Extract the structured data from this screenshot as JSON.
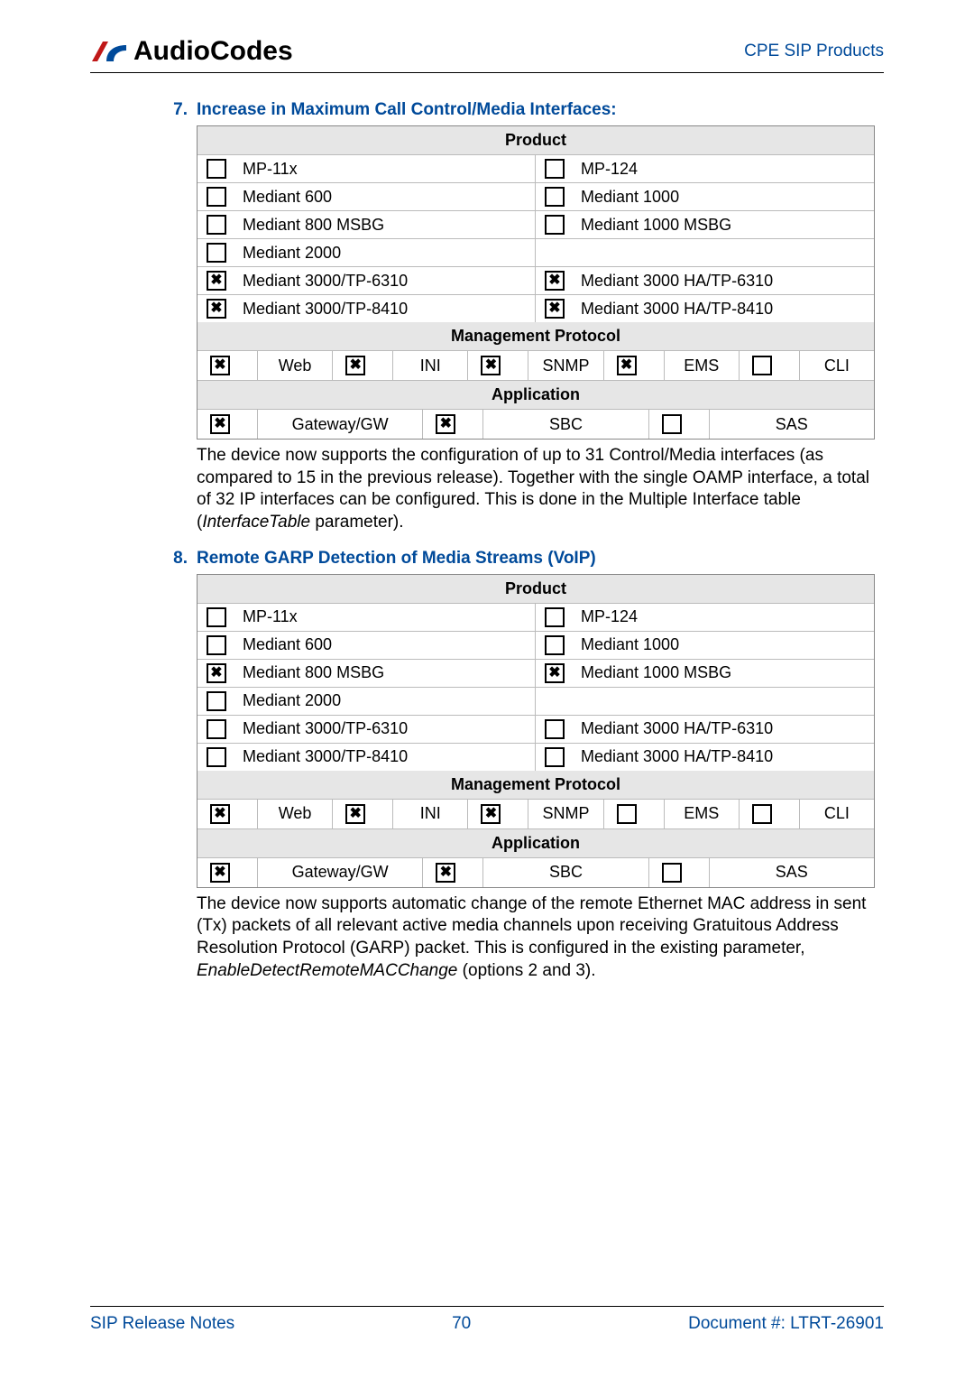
{
  "header": {
    "logo_text": "AudioCodes",
    "right_text": "CPE SIP Products"
  },
  "section7": {
    "num": "7.",
    "title": "Increase in Maximum Call Control/Media Interfaces:",
    "product_header": "Product",
    "products": [
      {
        "left": {
          "checked": false,
          "label": "MP-11x"
        },
        "right": {
          "checked": false,
          "label": "MP-124"
        }
      },
      {
        "left": {
          "checked": false,
          "label": "Mediant 600"
        },
        "right": {
          "checked": false,
          "label": "Mediant 1000"
        }
      },
      {
        "left": {
          "checked": false,
          "label": "Mediant 800 MSBG"
        },
        "right": {
          "checked": false,
          "label": "Mediant 1000 MSBG"
        }
      },
      {
        "left": {
          "checked": false,
          "label": "Mediant 2000"
        },
        "right": null
      },
      {
        "left": {
          "checked": true,
          "label": "Mediant 3000/TP-6310"
        },
        "right": {
          "checked": true,
          "label": "Mediant 3000 HA/TP-6310"
        }
      },
      {
        "left": {
          "checked": true,
          "label": "Mediant 3000/TP-8410"
        },
        "right": {
          "checked": true,
          "label": "Mediant 3000 HA/TP-8410"
        }
      }
    ],
    "mgmt_header": "Management Protocol",
    "mgmt": [
      {
        "checked": true,
        "label": "Web"
      },
      {
        "checked": true,
        "label": "INI"
      },
      {
        "checked": true,
        "label": "SNMP"
      },
      {
        "checked": true,
        "label": "EMS"
      },
      {
        "checked": false,
        "label": "CLI"
      }
    ],
    "app_header": "Application",
    "app": [
      {
        "checked": true,
        "label": "Gateway/GW"
      },
      {
        "checked": true,
        "label": "SBC"
      },
      {
        "checked": false,
        "label": "SAS"
      }
    ],
    "desc_1": "The device now supports the configuration of up to 31 Control/Media interfaces (as compared to 15 in the previous release). Together with the single OAMP interface, a total of 32 IP interfaces can be configured. This is done in the Multiple Interface table (",
    "desc_italic": "InterfaceTable",
    "desc_2": " parameter)."
  },
  "section8": {
    "num": "8.",
    "title": "Remote GARP Detection of Media Streams (VoIP)",
    "product_header": "Product",
    "products": [
      {
        "left": {
          "checked": false,
          "label": "MP-11x"
        },
        "right": {
          "checked": false,
          "label": "MP-124"
        }
      },
      {
        "left": {
          "checked": false,
          "label": "Mediant 600"
        },
        "right": {
          "checked": false,
          "label": "Mediant 1000"
        }
      },
      {
        "left": {
          "checked": true,
          "label": "Mediant 800 MSBG"
        },
        "right": {
          "checked": true,
          "label": "Mediant 1000 MSBG"
        }
      },
      {
        "left": {
          "checked": false,
          "label": "Mediant 2000"
        },
        "right": null
      },
      {
        "left": {
          "checked": false,
          "label": "Mediant 3000/TP-6310"
        },
        "right": {
          "checked": false,
          "label": "Mediant 3000 HA/TP-6310"
        }
      },
      {
        "left": {
          "checked": false,
          "label": "Mediant 3000/TP-8410"
        },
        "right": {
          "checked": false,
          "label": "Mediant 3000 HA/TP-8410"
        }
      }
    ],
    "mgmt_header": "Management Protocol",
    "mgmt": [
      {
        "checked": true,
        "label": "Web"
      },
      {
        "checked": true,
        "label": "INI"
      },
      {
        "checked": true,
        "label": "SNMP"
      },
      {
        "checked": false,
        "label": "EMS"
      },
      {
        "checked": false,
        "label": "CLI"
      }
    ],
    "app_header": "Application",
    "app": [
      {
        "checked": true,
        "label": "Gateway/GW"
      },
      {
        "checked": true,
        "label": "SBC"
      },
      {
        "checked": false,
        "label": "SAS"
      }
    ],
    "desc_1": "The device now supports automatic change of the remote Ethernet MAC address in sent (Tx) packets of all relevant active media channels upon receiving Gratuitous Address Resolution Protocol (GARP) packet. This is configured in the existing parameter, ",
    "desc_italic": "EnableDetectRemoteMACChange",
    "desc_2": " (options 2 and 3)."
  },
  "footer": {
    "left": "SIP Release Notes",
    "center": "70",
    "right": "Document #: LTRT-26901"
  }
}
